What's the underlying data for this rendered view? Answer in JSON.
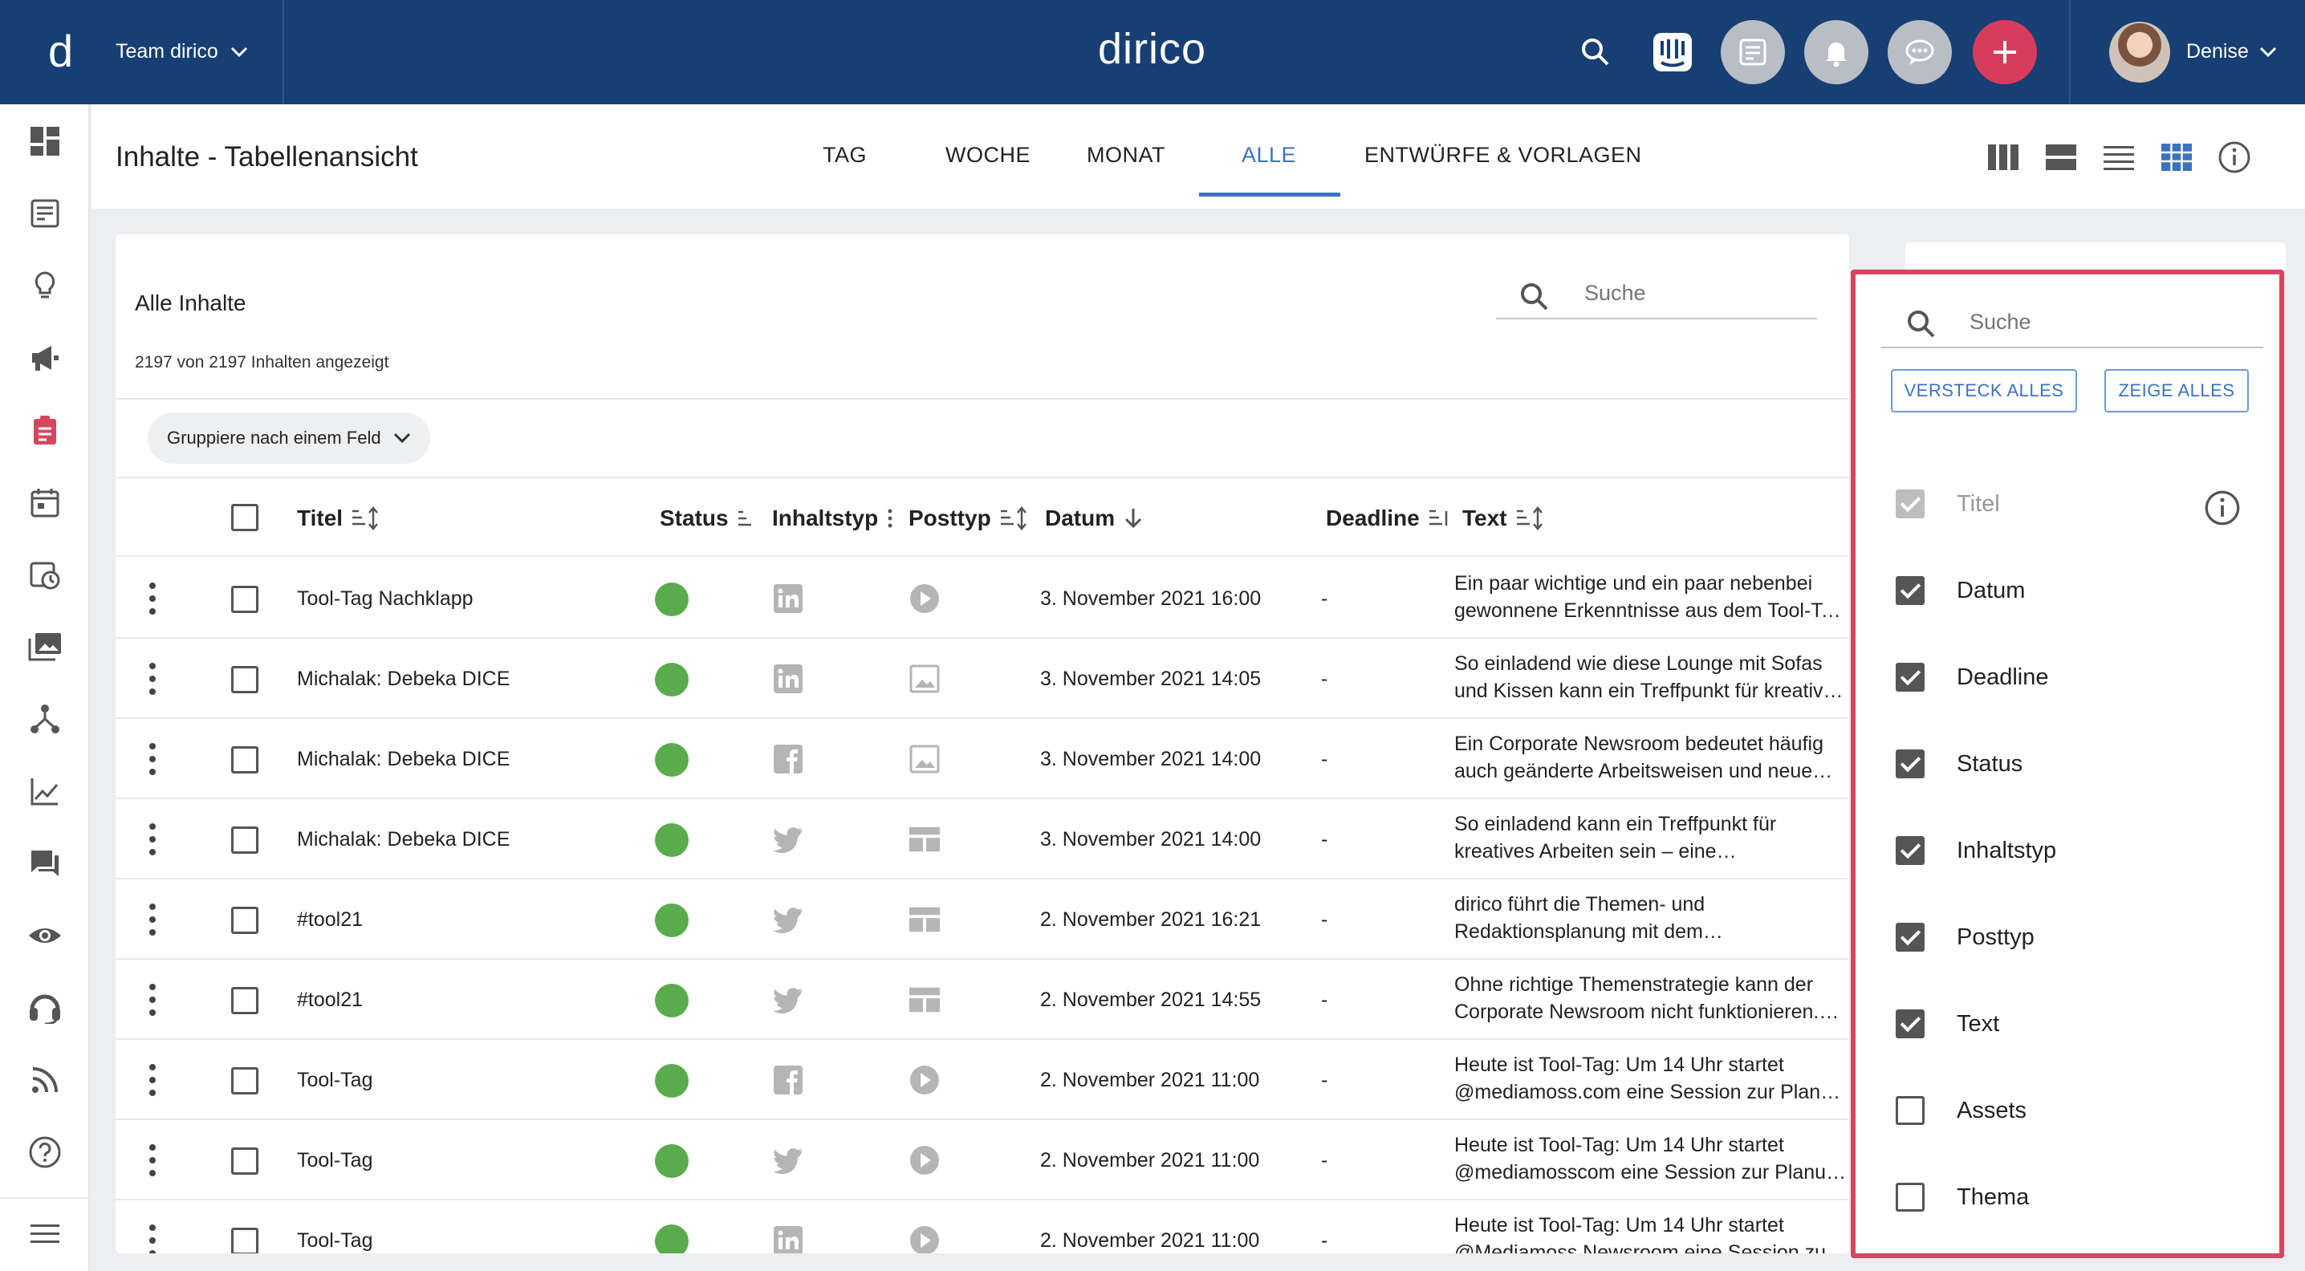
{
  "topbar": {
    "logo": "d",
    "team": "Team dirico",
    "brand": "dirico",
    "user": "Denise"
  },
  "header": {
    "title": "Inhalte - Tabellenansicht",
    "tabs": [
      {
        "label": "TAG"
      },
      {
        "label": "WOCHE"
      },
      {
        "label": "MONAT"
      },
      {
        "label": "ALLE",
        "active": true
      },
      {
        "label": "ENTWÜRFE & VORLAGEN"
      }
    ]
  },
  "card": {
    "title": "Alle Inhalte",
    "count": "2197 von 2197 Inhalten angezeigt",
    "search_placeholder": "Suche",
    "group_label": "Gruppiere nach einem Feld"
  },
  "table": {
    "columns": {
      "titel": "Titel",
      "status": "Status",
      "inhaltstyp": "Inhaltstyp",
      "posttyp": "Posttyp",
      "datum": "Datum",
      "deadline": "Deadline",
      "text": "Text"
    },
    "rows": [
      {
        "titel": "Tool-Tag Nachklapp",
        "inhaltstyp": "linkedin-icon",
        "posttyp": "video-icon",
        "datum": "3. November 2021 16:00",
        "deadline": "-",
        "text1": "Ein paar wichtige und ein paar nebenbei",
        "text2": "gewonnene Erkenntnisse aus dem Tool-Ta…"
      },
      {
        "titel": "Michalak: Debeka DICE",
        "inhaltstyp": "linkedin-icon",
        "posttyp": "image-icon",
        "datum": "3. November 2021 14:05",
        "deadline": "-",
        "text1": "So einladend wie diese Lounge mit Sofas",
        "text2": "und Kissen kann ein Treffpunkt für kreative…"
      },
      {
        "titel": "Michalak: Debeka DICE",
        "inhaltstyp": "facebook-icon",
        "posttyp": "image-icon",
        "datum": "3. November 2021 14:00",
        "deadline": "-",
        "text1": "Ein Corporate Newsroom bedeutet häufig",
        "text2": "auch geänderte Arbeitsweisen und neue…"
      },
      {
        "titel": "Michalak: Debeka DICE",
        "inhaltstyp": "twitter-icon",
        "posttyp": "card-icon",
        "datum": "3. November 2021 14:00",
        "deadline": "-",
        "text1": "So einladend kann ein Treffpunkt für",
        "text2": "kreatives Arbeiten sein – eine…"
      },
      {
        "titel": "#tool21",
        "inhaltstyp": "twitter-icon",
        "posttyp": "card-icon",
        "datum": "2. November 2021 16:21",
        "deadline": "-",
        "text1": "dirico führt die Themen- und",
        "text2": "Redaktionsplanung mit dem…"
      },
      {
        "titel": "#tool21",
        "inhaltstyp": "twitter-icon",
        "posttyp": "card-icon",
        "datum": "2. November 2021 14:55",
        "deadline": "-",
        "text1": "Ohne richtige Themenstrategie kann der",
        "text2": "Corporate Newsroom nicht funktionieren.…"
      },
      {
        "titel": "Tool-Tag",
        "inhaltstyp": "facebook-icon",
        "posttyp": "video-icon",
        "datum": "2. November 2021 11:00",
        "deadline": "-",
        "text1": "Heute ist Tool-Tag: Um 14 Uhr startet",
        "text2": "@mediamoss.com eine Session zur Planun…"
      },
      {
        "titel": "Tool-Tag",
        "inhaltstyp": "twitter-icon",
        "posttyp": "video-icon",
        "datum": "2. November 2021 11:00",
        "deadline": "-",
        "text1": "Heute ist Tool-Tag: Um 14 Uhr startet",
        "text2": "@mediamosscom eine Session zur Planun…"
      },
      {
        "titel": "Tool-Tag",
        "inhaltstyp": "linkedin-icon",
        "posttyp": "video-icon",
        "datum": "2. November 2021 11:00",
        "deadline": "-",
        "text1": "Heute ist Tool-Tag: Um 14 Uhr startet",
        "text2": "@Mediamoss Newsroom eine Session zur…"
      }
    ]
  },
  "panel": {
    "search_placeholder": "Suche",
    "hide_all": "VERSTECK ALLES",
    "show_all": "ZEIGE ALLES",
    "options": [
      {
        "label": "Titel",
        "state": "disabled"
      },
      {
        "label": "Datum",
        "state": "on"
      },
      {
        "label": "Deadline",
        "state": "on"
      },
      {
        "label": "Status",
        "state": "on"
      },
      {
        "label": "Inhaltstyp",
        "state": "on"
      },
      {
        "label": "Posttyp",
        "state": "on"
      },
      {
        "label": "Text",
        "state": "on"
      },
      {
        "label": "Assets",
        "state": "off"
      },
      {
        "label": "Thema",
        "state": "off"
      }
    ]
  },
  "colors": {
    "topbar": "#173f73",
    "accent": "#3b73c0",
    "status_green": "#5aab4c",
    "panel_border": "#d5475f",
    "add_button": "#d83c5c"
  }
}
